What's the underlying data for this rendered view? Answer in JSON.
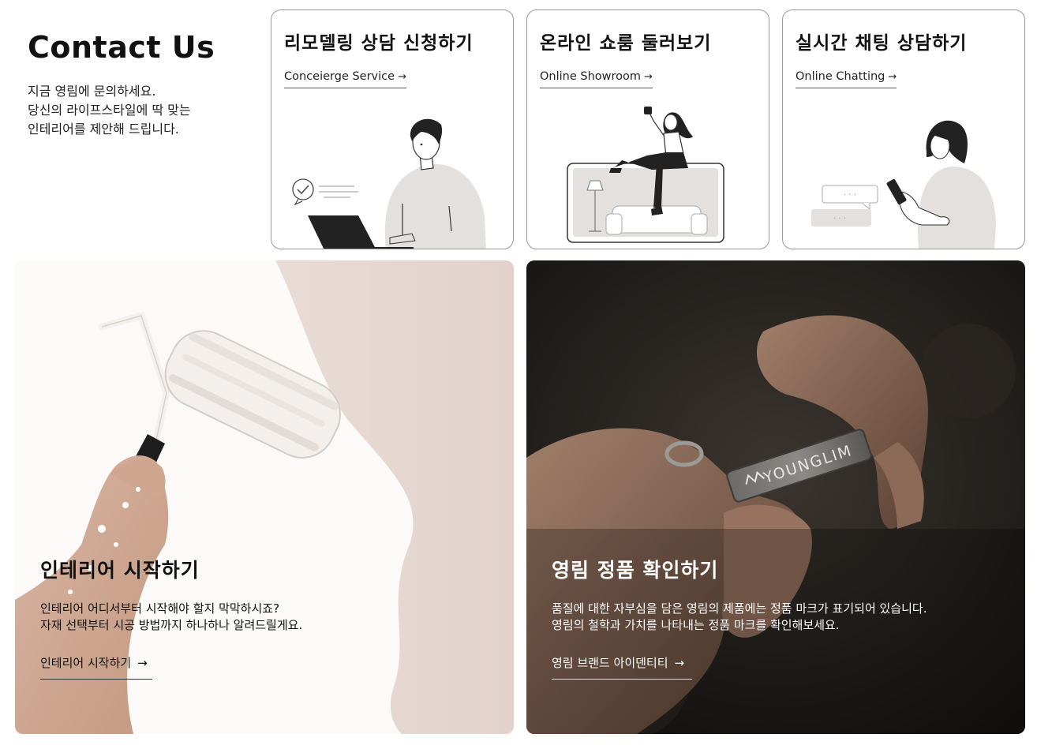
{
  "intro": {
    "title": "Contact Us",
    "lines": [
      "지금 영림에 문의하세요.",
      "당신의 라이프스타일에 딱 맞는",
      "인테리어를 제안해 드립니다."
    ]
  },
  "cards": [
    {
      "title": "리모델링 상담 신청하기",
      "link": "Conceierge Service",
      "arrow": "→",
      "illustration": "man-with-laptop"
    },
    {
      "title": "온라인 쇼룸 둘러보기",
      "link": "Online Showroom",
      "arrow": "→",
      "illustration": "woman-sitting-on-showroom-screen"
    },
    {
      "title": "실시간 채팅 상담하기",
      "link": "Online Chatting",
      "arrow": "→",
      "illustration": "woman-chatting-on-phone"
    }
  ],
  "banners": [
    {
      "title": "인테리어 시작하기",
      "desc": [
        "인테리어 어디서부터 시작해야 할지 막막하시죠?",
        "자재 선택부터 시공 방법까지 하나하나 알려드릴게요."
      ],
      "link": "인테리어 시작하기",
      "arrow": "→",
      "image": "paint-roller-on-wall"
    },
    {
      "title": "영림 정품 확인하기",
      "desc": [
        "품질에 대한 자부심을 담은 영림의 제품에는 정품 마크가 표기되어 있습니다.",
        "영림의 철학과 가치를 나타내는 정품 마크를 확인해보세요."
      ],
      "link": "영림 브랜드 아이덴티티",
      "arrow": "→",
      "image": "hands-holding-younglim-badge",
      "badge_text": "YOUNGLIM"
    }
  ],
  "colors": {
    "card_border": "#9a9a9a",
    "illustration_fill": "#e4e0dd",
    "illustration_dark": "#222222",
    "banner_light_bg": "#e8dcd6",
    "banner_dark_bg": "#1e1c1a"
  }
}
